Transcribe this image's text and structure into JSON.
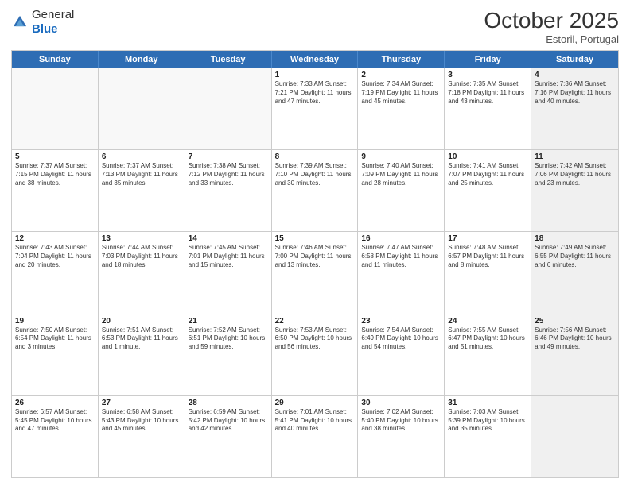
{
  "header": {
    "logo": {
      "general": "General",
      "blue": "Blue"
    },
    "month_year": "October 2025",
    "location": "Estoril, Portugal"
  },
  "days_of_week": [
    "Sunday",
    "Monday",
    "Tuesday",
    "Wednesday",
    "Thursday",
    "Friday",
    "Saturday"
  ],
  "weeks": [
    [
      {
        "num": "",
        "empty": true
      },
      {
        "num": "",
        "empty": true
      },
      {
        "num": "",
        "empty": true
      },
      {
        "num": "1",
        "info": "Sunrise: 7:33 AM\nSunset: 7:21 PM\nDaylight: 11 hours\nand 47 minutes."
      },
      {
        "num": "2",
        "info": "Sunrise: 7:34 AM\nSunset: 7:19 PM\nDaylight: 11 hours\nand 45 minutes."
      },
      {
        "num": "3",
        "info": "Sunrise: 7:35 AM\nSunset: 7:18 PM\nDaylight: 11 hours\nand 43 minutes."
      },
      {
        "num": "4",
        "info": "Sunrise: 7:36 AM\nSunset: 7:16 PM\nDaylight: 11 hours\nand 40 minutes.",
        "shaded": true
      }
    ],
    [
      {
        "num": "5",
        "info": "Sunrise: 7:37 AM\nSunset: 7:15 PM\nDaylight: 11 hours\nand 38 minutes."
      },
      {
        "num": "6",
        "info": "Sunrise: 7:37 AM\nSunset: 7:13 PM\nDaylight: 11 hours\nand 35 minutes."
      },
      {
        "num": "7",
        "info": "Sunrise: 7:38 AM\nSunset: 7:12 PM\nDaylight: 11 hours\nand 33 minutes."
      },
      {
        "num": "8",
        "info": "Sunrise: 7:39 AM\nSunset: 7:10 PM\nDaylight: 11 hours\nand 30 minutes."
      },
      {
        "num": "9",
        "info": "Sunrise: 7:40 AM\nSunset: 7:09 PM\nDaylight: 11 hours\nand 28 minutes."
      },
      {
        "num": "10",
        "info": "Sunrise: 7:41 AM\nSunset: 7:07 PM\nDaylight: 11 hours\nand 25 minutes."
      },
      {
        "num": "11",
        "info": "Sunrise: 7:42 AM\nSunset: 7:06 PM\nDaylight: 11 hours\nand 23 minutes.",
        "shaded": true
      }
    ],
    [
      {
        "num": "12",
        "info": "Sunrise: 7:43 AM\nSunset: 7:04 PM\nDaylight: 11 hours\nand 20 minutes."
      },
      {
        "num": "13",
        "info": "Sunrise: 7:44 AM\nSunset: 7:03 PM\nDaylight: 11 hours\nand 18 minutes."
      },
      {
        "num": "14",
        "info": "Sunrise: 7:45 AM\nSunset: 7:01 PM\nDaylight: 11 hours\nand 15 minutes."
      },
      {
        "num": "15",
        "info": "Sunrise: 7:46 AM\nSunset: 7:00 PM\nDaylight: 11 hours\nand 13 minutes."
      },
      {
        "num": "16",
        "info": "Sunrise: 7:47 AM\nSunset: 6:58 PM\nDaylight: 11 hours\nand 11 minutes."
      },
      {
        "num": "17",
        "info": "Sunrise: 7:48 AM\nSunset: 6:57 PM\nDaylight: 11 hours\nand 8 minutes."
      },
      {
        "num": "18",
        "info": "Sunrise: 7:49 AM\nSunset: 6:55 PM\nDaylight: 11 hours\nand 6 minutes.",
        "shaded": true
      }
    ],
    [
      {
        "num": "19",
        "info": "Sunrise: 7:50 AM\nSunset: 6:54 PM\nDaylight: 11 hours\nand 3 minutes."
      },
      {
        "num": "20",
        "info": "Sunrise: 7:51 AM\nSunset: 6:53 PM\nDaylight: 11 hours\nand 1 minute."
      },
      {
        "num": "21",
        "info": "Sunrise: 7:52 AM\nSunset: 6:51 PM\nDaylight: 10 hours\nand 59 minutes."
      },
      {
        "num": "22",
        "info": "Sunrise: 7:53 AM\nSunset: 6:50 PM\nDaylight: 10 hours\nand 56 minutes."
      },
      {
        "num": "23",
        "info": "Sunrise: 7:54 AM\nSunset: 6:49 PM\nDaylight: 10 hours\nand 54 minutes."
      },
      {
        "num": "24",
        "info": "Sunrise: 7:55 AM\nSunset: 6:47 PM\nDaylight: 10 hours\nand 51 minutes."
      },
      {
        "num": "25",
        "info": "Sunrise: 7:56 AM\nSunset: 6:46 PM\nDaylight: 10 hours\nand 49 minutes.",
        "shaded": true
      }
    ],
    [
      {
        "num": "26",
        "info": "Sunrise: 6:57 AM\nSunset: 5:45 PM\nDaylight: 10 hours\nand 47 minutes."
      },
      {
        "num": "27",
        "info": "Sunrise: 6:58 AM\nSunset: 5:43 PM\nDaylight: 10 hours\nand 45 minutes."
      },
      {
        "num": "28",
        "info": "Sunrise: 6:59 AM\nSunset: 5:42 PM\nDaylight: 10 hours\nand 42 minutes."
      },
      {
        "num": "29",
        "info": "Sunrise: 7:01 AM\nSunset: 5:41 PM\nDaylight: 10 hours\nand 40 minutes."
      },
      {
        "num": "30",
        "info": "Sunrise: 7:02 AM\nSunset: 5:40 PM\nDaylight: 10 hours\nand 38 minutes."
      },
      {
        "num": "31",
        "info": "Sunrise: 7:03 AM\nSunset: 5:39 PM\nDaylight: 10 hours\nand 35 minutes."
      },
      {
        "num": "",
        "empty": true,
        "shaded": true
      }
    ]
  ]
}
